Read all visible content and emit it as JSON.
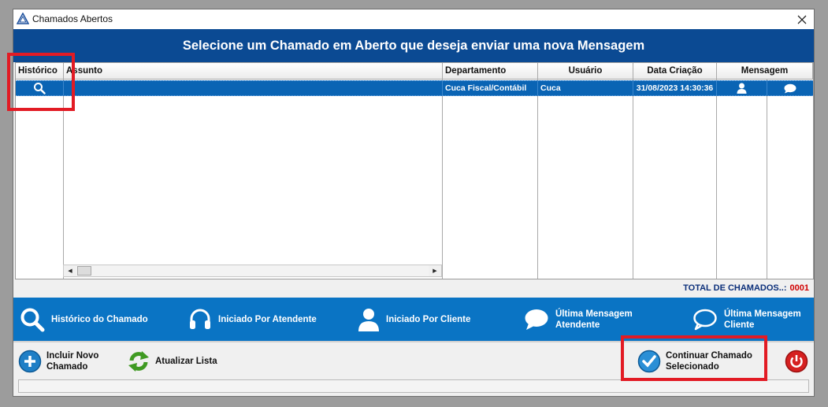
{
  "window": {
    "title": "Chamados Abertos"
  },
  "banner": {
    "text": "Selecione um Chamado em Aberto que deseja enviar uma nova Mensagem"
  },
  "grid": {
    "columns": [
      "Histórico",
      "Assunto",
      "Departamento",
      "Usuário",
      "Data Criação",
      "Mensagem"
    ],
    "rows": [
      {
        "assunto": "",
        "departamento": "Cuca Fiscal/Contábil",
        "usuario": "Cuca",
        "data_criacao": "31/08/2023 14:30:36"
      }
    ]
  },
  "total": {
    "label": "TOTAL DE CHAMADOS..:",
    "value": "0001"
  },
  "legend": [
    {
      "icon": "magnifier-icon",
      "line1": "Histórico do Chamado",
      "line2": ""
    },
    {
      "icon": "headset-icon",
      "line1": "Iniciado Por Atendente",
      "line2": ""
    },
    {
      "icon": "person-icon",
      "line1": "Iniciado Por Cliente",
      "line2": ""
    },
    {
      "icon": "speech-bubble-icon",
      "line1": "Última Mensagem",
      "line2": "Atendente"
    },
    {
      "icon": "speech-bubble-outline-icon",
      "line1": "Última Mensagem",
      "line2": "Cliente"
    }
  ],
  "toolbar": {
    "new_line1": "Incluir Novo",
    "new_line2": "Chamado",
    "refresh_label": "Atualizar Lista",
    "continue_line1": "Continuar Chamado",
    "continue_line2": "Selecionado"
  },
  "colors": {
    "banner": "#0b4a93",
    "legend": "#0a74c4",
    "selected_row": "#0a64b4",
    "highlight": "#e21b24",
    "total_value": "#d10000"
  }
}
